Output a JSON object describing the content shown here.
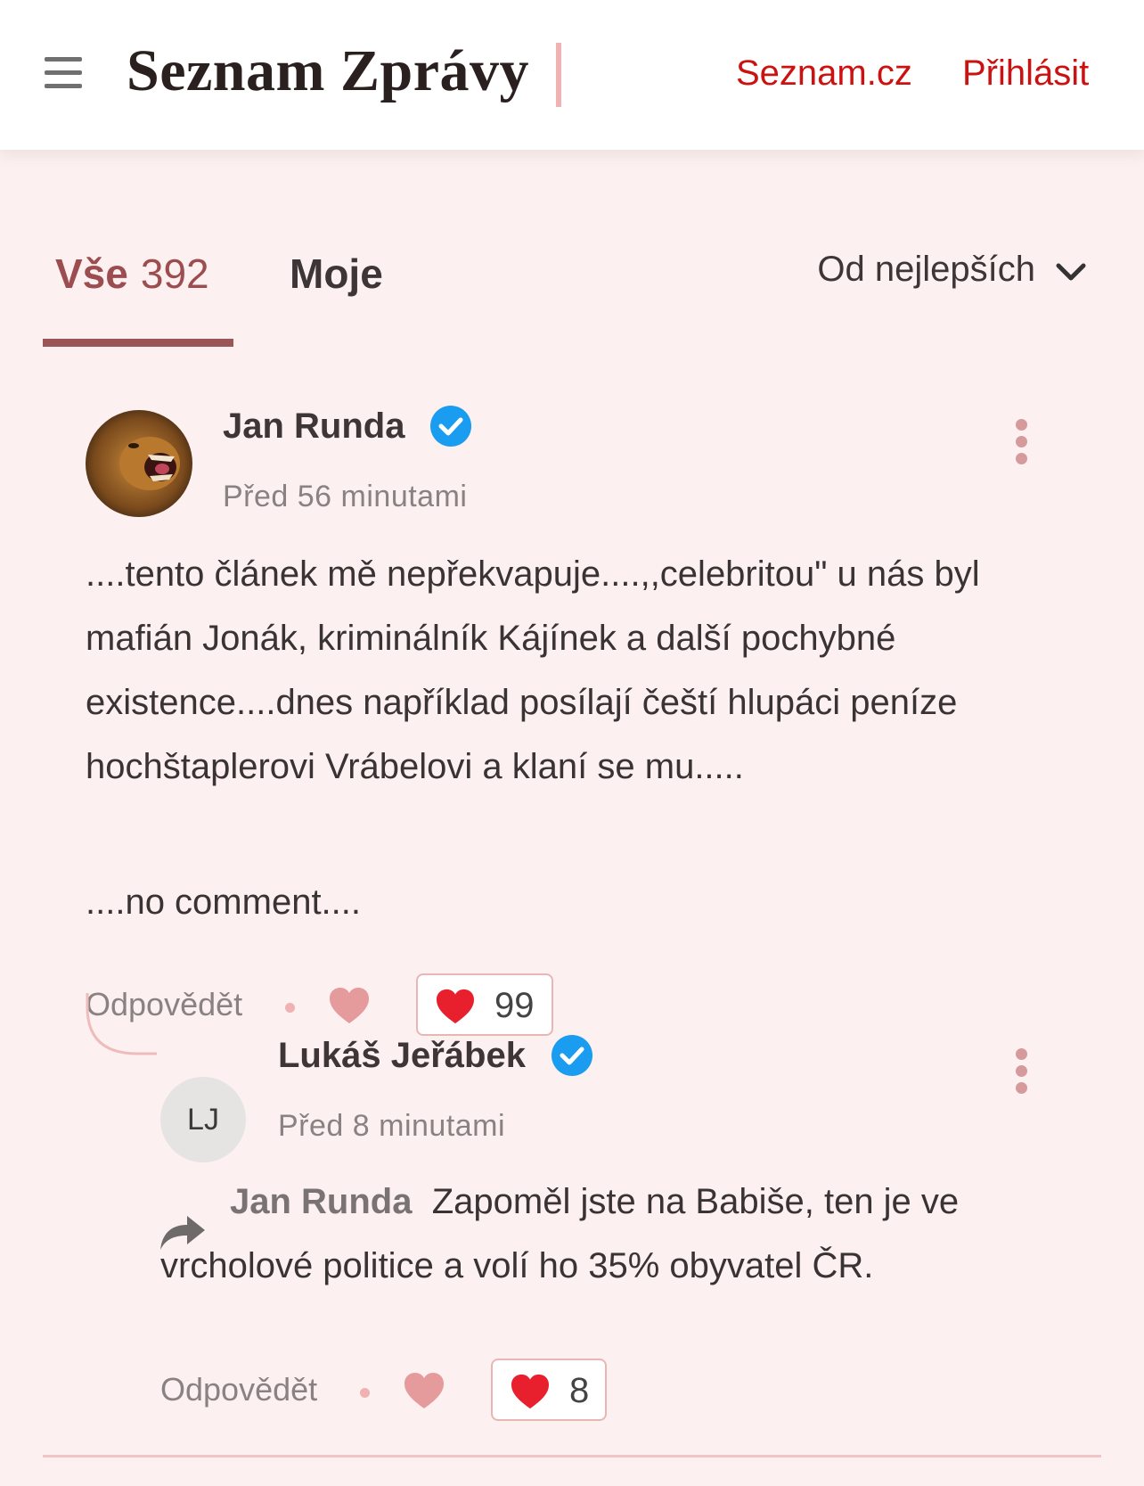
{
  "header": {
    "logo": "Seznam Zprávy",
    "seznam_link": "Seznam.cz",
    "login_link": "Přihlásit"
  },
  "tabs": {
    "all_label": "Vše",
    "all_count": "392",
    "mine_label": "Moje",
    "sort_label": "Od nejlepších"
  },
  "comments": [
    {
      "author": "Jan Runda",
      "verified": true,
      "time": "Před 56 minutami",
      "paragraphs": [
        "....tento článek mě nepřekvapuje....,,celebritou\" u nás byl mafián Jonák, kriminálník Kájínek a další pochybné existence....dnes například posílají čeští hlupáci peníze hochštaplerovi Vrábelovi a klaní se mu.....",
        "....no comment...."
      ],
      "reply_label": "Odpovědět",
      "likes": "99"
    },
    {
      "author": "Lukáš Jeřábek",
      "avatar_initials": "LJ",
      "verified": true,
      "time": "Před 8 minutami",
      "reply_to": "Jan Runda",
      "text": "Zapoměl jste na Babiše, ten je ve vrcholové politice a volí ho 35% obyvatel ČR.",
      "reply_label": "Odpovědět",
      "likes": "8"
    }
  ],
  "icons": {
    "menu": "hamburger-menu-icon",
    "sort": "chevron-down-icon",
    "verified": "verified-check-icon",
    "more": "more-vertical-icon",
    "like": "heart-icon",
    "reply_to": "reply-arrow-icon"
  },
  "colors": {
    "brand_red": "#cc1111",
    "tab_active": "#9c4d4f",
    "verified_blue": "#1a9cf0",
    "heart_red": "#e8202e",
    "background": "#fcf1f0"
  }
}
